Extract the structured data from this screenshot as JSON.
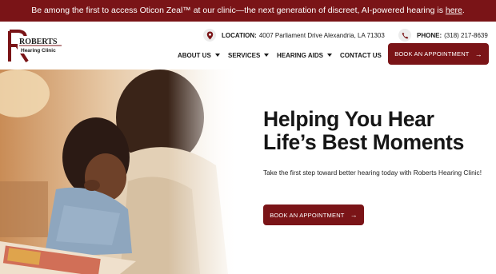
{
  "announcement": {
    "text": "Be among the first to access Oticon Zeal™ at our clinic—the next generation of discreet, AI-powered hearing is ",
    "link": "here",
    "tail": "."
  },
  "logo": {
    "brand_line1": "ROBERTS",
    "brand_line2": "Hearing Clinic"
  },
  "location": {
    "label": "LOCATION:",
    "value": "4007 Parliament Drive Alexandria, LA 71303"
  },
  "phone": {
    "label": "PHONE:",
    "value": "(318) 217-8639"
  },
  "nav": {
    "about": "ABOUT US",
    "services": "SERVICES",
    "hearing_aids": "HEARING AIDS",
    "contact": "CONTACT US"
  },
  "header_button": "BOOK AN APPOINTMENT",
  "hero": {
    "title_line1": "Helping You Hear",
    "title_line2": "Life’s Best Moments",
    "subtitle": "Take the first step toward better hearing today with Roberts Hearing Clinic!",
    "button": "BOOK AN APPOINTMENT"
  },
  "colors": {
    "brand": "#7a1417",
    "text": "#1a1a1a"
  },
  "icons": {
    "location": "map-pin-icon",
    "phone": "phone-icon",
    "arrow": "arrow-right-icon",
    "dropdown": "chevron-down-icon"
  }
}
